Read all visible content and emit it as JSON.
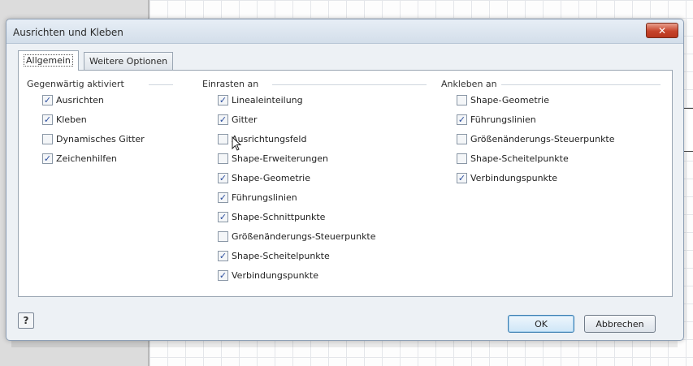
{
  "dialog": {
    "title": "Ausrichten und Kleben",
    "close_label": "✕",
    "tabs": [
      {
        "label": "Allgemein",
        "active": true
      },
      {
        "label": "Weitere Optionen",
        "active": false
      }
    ],
    "groups": [
      {
        "title": "Gegenwärtig aktiviert",
        "items": [
          {
            "label": "Ausrichten",
            "checked": true
          },
          {
            "label": "Kleben",
            "checked": true
          },
          {
            "label": "Dynamisches Gitter",
            "checked": false
          },
          {
            "label": "Zeichenhilfen",
            "checked": true
          }
        ]
      },
      {
        "title": "Einrasten an",
        "items": [
          {
            "label": "Linealeinteilung",
            "checked": true
          },
          {
            "label": "Gitter",
            "checked": true
          },
          {
            "label": "Ausrichtungsfeld",
            "checked": false
          },
          {
            "label": "Shape-Erweiterungen",
            "checked": false
          },
          {
            "label": "Shape-Geometrie",
            "checked": true
          },
          {
            "label": "Führungslinien",
            "checked": true
          },
          {
            "label": "Shape-Schnittpunkte",
            "checked": true
          },
          {
            "label": "Größenänderungs-Steuerpunkte",
            "checked": false
          },
          {
            "label": "Shape-Scheitelpunkte",
            "checked": true
          },
          {
            "label": "Verbindungspunkte",
            "checked": true
          }
        ]
      },
      {
        "title": "Ankleben an",
        "items": [
          {
            "label": "Shape-Geometrie",
            "checked": false
          },
          {
            "label": "Führungslinien",
            "checked": true
          },
          {
            "label": "Größenänderungs-Steuerpunkte",
            "checked": false
          },
          {
            "label": "Shape-Scheitelpunkte",
            "checked": false
          },
          {
            "label": "Verbindungspunkte",
            "checked": true
          }
        ]
      }
    ],
    "buttons": {
      "ok_label": "OK",
      "cancel_label": "Abbrechen"
    },
    "help_icon": "help-icon"
  },
  "colors": {
    "check": "#2b4d9e",
    "close": "#c6432a",
    "dialog_bg": "#edf1f5"
  }
}
